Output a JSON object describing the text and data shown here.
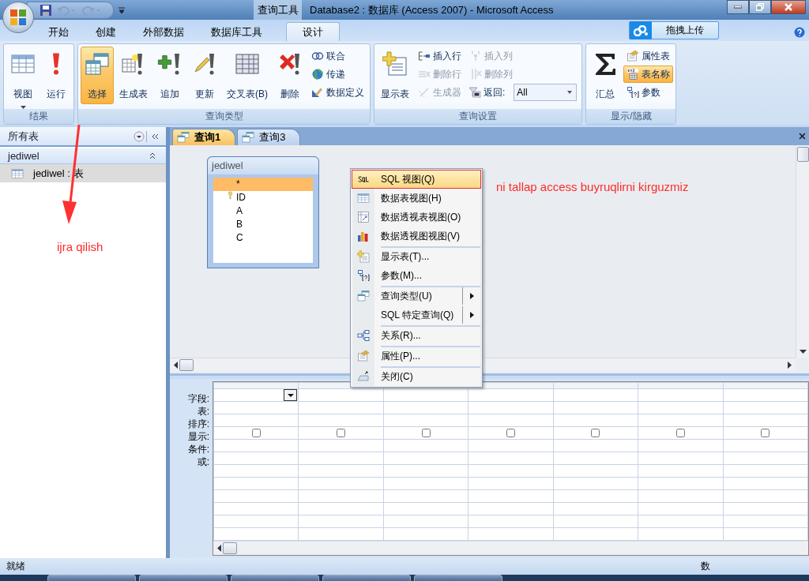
{
  "window": {
    "title": "Database2 : 数据库 (Access 2007)  -  Microsoft Access",
    "context_tab_group": "查询工具"
  },
  "ribbon_tabs": [
    {
      "label": "开始",
      "selected": false
    },
    {
      "label": "创建",
      "selected": false
    },
    {
      "label": "外部数据",
      "selected": false
    },
    {
      "label": "数据库工具",
      "selected": false
    },
    {
      "label": "设计",
      "selected": true
    }
  ],
  "upload_button": "拖拽上传",
  "ribbon_groups": [
    {
      "title": "结果",
      "items": [
        {
          "label": "视图",
          "kind": "split",
          "selected": false,
          "disabled": false
        },
        {
          "label": "运行",
          "kind": "large",
          "selected": false,
          "disabled": false
        }
      ]
    },
    {
      "title": "查询类型",
      "items": [
        {
          "label": "选择",
          "kind": "large",
          "selected": true,
          "disabled": false
        },
        {
          "label": "生成表",
          "kind": "large",
          "selected": false,
          "disabled": false
        },
        {
          "label": "追加",
          "kind": "large",
          "selected": false,
          "disabled": false
        },
        {
          "label": "更新",
          "kind": "large",
          "selected": false,
          "disabled": false
        },
        {
          "label": "交叉表(B)",
          "kind": "large",
          "selected": false,
          "disabled": false
        },
        {
          "label": "删除",
          "kind": "large",
          "selected": false,
          "disabled": false
        },
        {
          "label": "联合",
          "kind": "small",
          "selected": false,
          "disabled": false
        },
        {
          "label": "传递",
          "kind": "small",
          "selected": false,
          "disabled": false
        },
        {
          "label": "数据定义",
          "kind": "small",
          "selected": false,
          "disabled": false
        }
      ]
    },
    {
      "title": "查询设置",
      "items": [
        {
          "label": "显示表",
          "kind": "large",
          "selected": false,
          "disabled": false
        },
        {
          "label": "插入行",
          "kind": "small",
          "selected": false,
          "disabled": false
        },
        {
          "label": "删除行",
          "kind": "small",
          "selected": false,
          "disabled": true
        },
        {
          "label": "生成器",
          "kind": "small",
          "selected": false,
          "disabled": true
        },
        {
          "label": "插入列",
          "kind": "small",
          "selected": false,
          "disabled": true
        },
        {
          "label": "删除列",
          "kind": "small",
          "selected": false,
          "disabled": true
        },
        {
          "label": "返回:",
          "value": "All",
          "kind": "combo",
          "selected": false,
          "disabled": false
        }
      ]
    },
    {
      "title": "显示/隐藏",
      "items": [
        {
          "label": "汇总",
          "kind": "large",
          "selected": false,
          "disabled": false
        },
        {
          "label": "属性表",
          "kind": "small",
          "selected": false,
          "disabled": false
        },
        {
          "label": "表名称",
          "kind": "small",
          "selected": true,
          "disabled": false
        },
        {
          "label": "参数",
          "kind": "small",
          "selected": false,
          "disabled": false
        }
      ]
    }
  ],
  "nav_pane": {
    "title": "所有表",
    "group": "jediwel",
    "items": [
      {
        "label": "jediwel : 表",
        "selected": true
      }
    ]
  },
  "document_tabs": [
    {
      "label": "查询1",
      "selected": true
    },
    {
      "label": "查询3",
      "selected": false
    }
  ],
  "field_list": {
    "title": "jediwel",
    "fields": [
      {
        "name": "*",
        "selected": true,
        "key": false
      },
      {
        "name": "ID",
        "selected": false,
        "key": true
      },
      {
        "name": "A",
        "selected": false,
        "key": false
      },
      {
        "name": "B",
        "selected": false,
        "key": false
      },
      {
        "name": "C",
        "selected": false,
        "key": false
      }
    ]
  },
  "context_menu": [
    {
      "label": "SQL 视图(Q)",
      "selected": true,
      "submenu": false,
      "separator_before": false
    },
    {
      "label": "数据表视图(H)",
      "selected": false,
      "submenu": false,
      "separator_before": false
    },
    {
      "label": "数据透视表视图(O)",
      "selected": false,
      "submenu": false,
      "separator_before": false
    },
    {
      "label": "数据透视图视图(V)",
      "selected": false,
      "submenu": false,
      "separator_before": false
    },
    {
      "label": "显示表(T)...",
      "selected": false,
      "submenu": false,
      "separator_before": true
    },
    {
      "label": "参数(M)...",
      "selected": false,
      "submenu": false,
      "separator_before": false
    },
    {
      "label": "查询类型(U)",
      "selected": false,
      "submenu": true,
      "separator_before": true
    },
    {
      "label": "SQL 特定查询(Q)",
      "selected": false,
      "submenu": true,
      "separator_before": false
    },
    {
      "label": "关系(R)...",
      "selected": false,
      "submenu": false,
      "separator_before": true
    },
    {
      "label": "属性(P)...",
      "selected": false,
      "submenu": false,
      "separator_before": true
    },
    {
      "label": "关闭(C)",
      "selected": false,
      "submenu": false,
      "separator_before": true
    }
  ],
  "design_grid": {
    "row_labels": [
      "字段:",
      "表:",
      "排序:",
      "显示:",
      "条件:",
      "或:"
    ],
    "columns": [
      {
        "show": false
      },
      {
        "show": false
      },
      {
        "show": false
      },
      {
        "show": false
      },
      {
        "show": false
      },
      {
        "show": false
      },
      {
        "show": false
      }
    ]
  },
  "annotations": [
    {
      "text": "ijra qilish"
    },
    {
      "text": "ni tallap  access buyruqlirni kirguzmiz"
    }
  ],
  "status_bar": {
    "left": "就绪",
    "right": "数"
  }
}
